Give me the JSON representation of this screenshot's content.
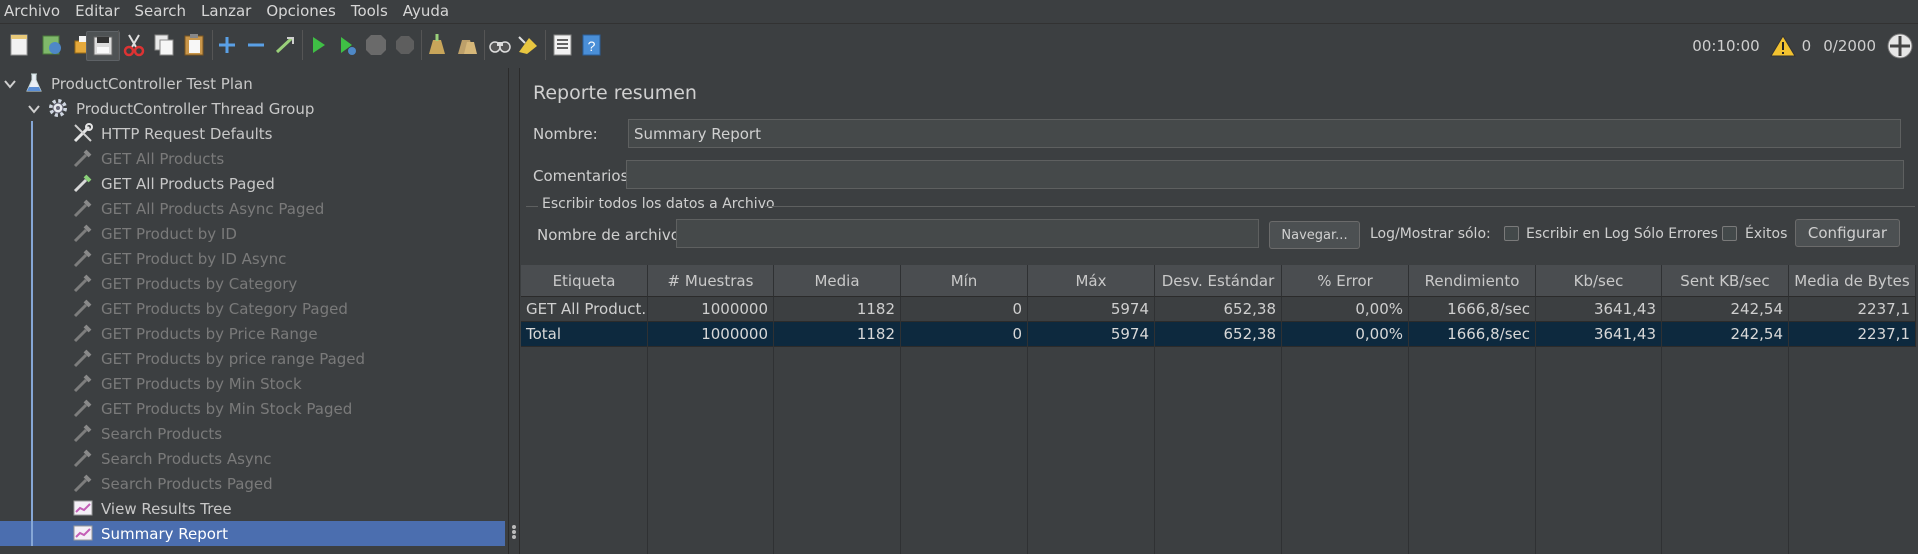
{
  "menu": [
    "Archivo",
    "Editar",
    "Search",
    "Lanzar",
    "Opciones",
    "Tools",
    "Ayuda"
  ],
  "toolbar": {
    "icons": [
      "new-icon",
      "templates-icon",
      "open-icon",
      "save-icon",
      "cut-icon",
      "copy-icon",
      "paste-icon",
      "expand-icon",
      "collapse-icon",
      "toggle-icon",
      "start-icon",
      "start-no-pauses-icon",
      "stop-icon",
      "shutdown-icon",
      "clear-icon",
      "clear-all-icon",
      "search-icon",
      "reset-search-icon",
      "function-helper-icon",
      "help-icon"
    ],
    "timer": "00:10:00",
    "warnings": "0",
    "threads": "0/2000"
  },
  "tree": {
    "items": [
      {
        "label": "ProductController Test Plan",
        "icon": "flask-icon",
        "enabled": true
      },
      {
        "label": "ProductController Thread Group",
        "icon": "gear-icon",
        "enabled": true
      },
      {
        "label": "HTTP Request Defaults",
        "icon": "wrench-icon",
        "enabled": true
      },
      {
        "label": "GET All Products",
        "icon": "pipette-icon",
        "enabled": false
      },
      {
        "label": "GET All Products Paged",
        "icon": "pipette-icon",
        "enabled": true
      },
      {
        "label": "GET All Products  Async Paged",
        "icon": "pipette-icon",
        "enabled": false
      },
      {
        "label": "GET Product by ID",
        "icon": "pipette-icon",
        "enabled": false
      },
      {
        "label": "GET Product by ID Async",
        "icon": "pipette-icon",
        "enabled": false
      },
      {
        "label": "GET Products by Category",
        "icon": "pipette-icon",
        "enabled": false
      },
      {
        "label": "GET Products by Category Paged",
        "icon": "pipette-icon",
        "enabled": false
      },
      {
        "label": "GET Products by Price Range",
        "icon": "pipette-icon",
        "enabled": false
      },
      {
        "label": "GET Products by price range Paged",
        "icon": "pipette-icon",
        "enabled": false
      },
      {
        "label": "GET Products by Min Stock",
        "icon": "pipette-icon",
        "enabled": false
      },
      {
        "label": "GET Products by Min Stock Paged",
        "icon": "pipette-icon",
        "enabled": false
      },
      {
        "label": "Search Products",
        "icon": "pipette-icon",
        "enabled": false
      },
      {
        "label": "Search Products Async",
        "icon": "pipette-icon",
        "enabled": false
      },
      {
        "label": "Search Products Paged",
        "icon": "pipette-icon",
        "enabled": false
      },
      {
        "label": "View Results Tree",
        "icon": "chart-icon",
        "enabled": true
      },
      {
        "label": "Summary Report",
        "icon": "chart-icon",
        "enabled": true,
        "selected": true
      }
    ]
  },
  "panel": {
    "title": "Reporte resumen",
    "name_label": "Nombre:",
    "name_value": "Summary Report",
    "comments_label": "Comentarios",
    "comments_value": "",
    "file_group_label": "Escribir todos los datos a Archivo",
    "filename_label": "Nombre de archivo",
    "filename_value": "",
    "browse_button": "Navegar...",
    "log_label": "Log/Mostrar sólo:",
    "errors_label": "Escribir en Log Sólo Errores",
    "success_label": "Éxitos",
    "configure_button": "Configurar"
  },
  "table": {
    "headers": [
      "Etiqueta",
      "# Muestras",
      "Media",
      "Mín",
      "Máx",
      "Desv. Estándar",
      "% Error",
      "Rendimiento",
      "Kb/sec",
      "Sent KB/sec",
      "Media de Bytes"
    ],
    "rows": [
      [
        "GET All Product...",
        "1000000",
        "1182",
        "0",
        "5974",
        "652,38",
        "0,00%",
        "1666,8/sec",
        "3641,43",
        "242,54",
        "2237,1"
      ],
      [
        "Total",
        "1000000",
        "1182",
        "0",
        "5974",
        "652,38",
        "0,00%",
        "1666,8/sec",
        "3641,43",
        "242,54",
        "2237,1"
      ]
    ]
  },
  "colors": {
    "background": "#3c3f41",
    "selection": "#4b6eaf",
    "total_row": "#0d293e"
  }
}
